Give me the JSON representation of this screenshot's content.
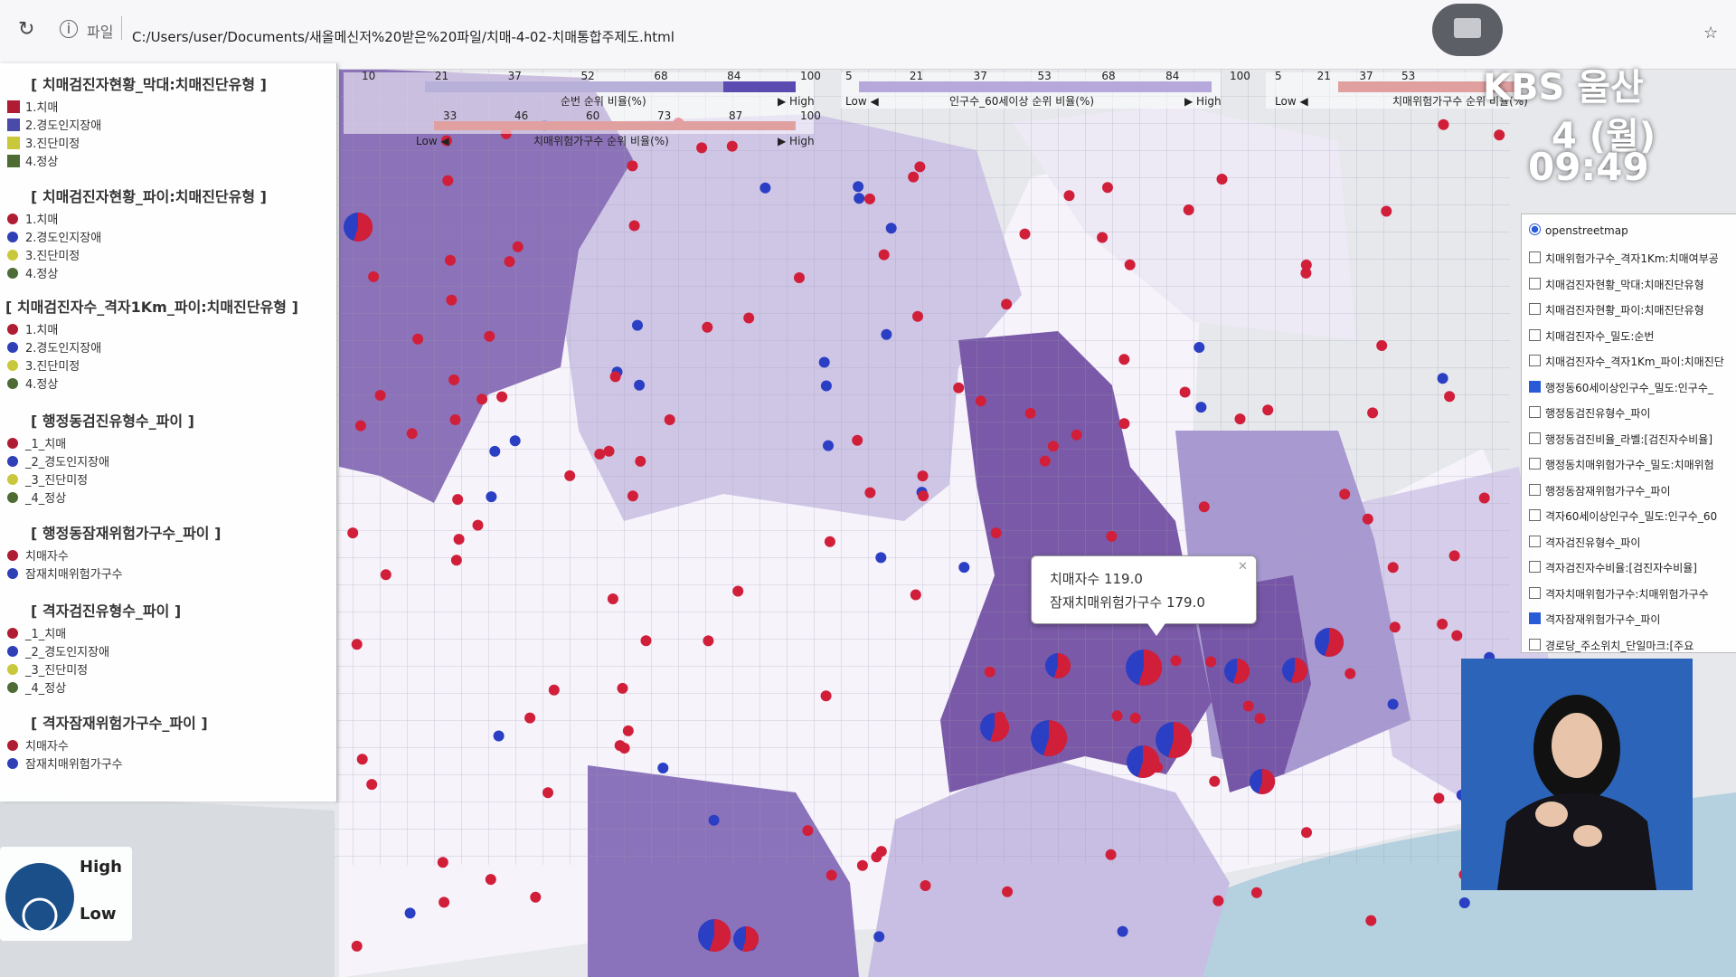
{
  "browser": {
    "file_label": "파일",
    "url": "C:/Users/user/Documents/새올메신저%20받은%20파일/치매-4-02-치매통합주제도.html"
  },
  "scales": [
    {
      "ticks": [
        "10",
        "21",
        "37",
        "52",
        "68",
        "84",
        "100"
      ],
      "label": "순번 순위 비율(%)",
      "low": "",
      "high": "High"
    },
    {
      "ticks": [
        "5",
        "21",
        "37",
        "53",
        "68",
        "84",
        "100"
      ],
      "label": "인구수_60세이상 순위 비율(%)",
      "low": "Low",
      "high": "High"
    },
    {
      "ticks": [
        "5",
        "21",
        "37",
        "53"
      ],
      "label": "치매위험가구수 순위 비율(%)",
      "low": "Low",
      "high": ""
    },
    {
      "ticks": [
        "33",
        "46",
        "60",
        "73",
        "87",
        "100"
      ],
      "label": "치매위험가구수 순위 비율(%)",
      "low": "Low",
      "high": "High"
    }
  ],
  "legend": {
    "sections": [
      {
        "title": "[ 치매검진자현황_막대:치매진단유형 ]",
        "kind": "bar",
        "items": [
          {
            "label": "1.치매",
            "color": "#b01c34"
          },
          {
            "label": "2.경도인지장애",
            "color": "#4a4aa8"
          },
          {
            "label": "3.진단미정",
            "color": "#c8c83a"
          },
          {
            "label": "4.정상",
            "color": "#4f6b34"
          }
        ]
      },
      {
        "title": "[ 치매검진자현황_파이:치매진단유형 ]",
        "kind": "pie",
        "items": [
          {
            "label": "1.치매",
            "color": "#b01c34"
          },
          {
            "label": "2.경도인지장애",
            "color": "#2f3fb5"
          },
          {
            "label": "3.진단미정",
            "color": "#c8c83a"
          },
          {
            "label": "4.정상",
            "color": "#4f6b34"
          }
        ]
      },
      {
        "title": "[ 치매검진자수_격자1Km_파이:치매진단유형 ]",
        "kind": "pie",
        "items": [
          {
            "label": "1.치매",
            "color": "#b01c34"
          },
          {
            "label": "2.경도인지장애",
            "color": "#2f3fb5"
          },
          {
            "label": "3.진단미정",
            "color": "#c8c83a"
          },
          {
            "label": "4.정상",
            "color": "#4f6b34"
          }
        ]
      },
      {
        "title": "[ 행정동검진유형수_파이 ]",
        "kind": "pie",
        "items": [
          {
            "label": "_1_치매",
            "color": "#b01c34"
          },
          {
            "label": "_2_경도인지장애",
            "color": "#2f3fb5"
          },
          {
            "label": "_3_진단미정",
            "color": "#c8c83a"
          },
          {
            "label": "_4_정상",
            "color": "#4f6b34"
          }
        ]
      },
      {
        "title": "[ 행정동잠재위험가구수_파이 ]",
        "kind": "pie",
        "items": [
          {
            "label": "치매자수",
            "color": "#b01c34"
          },
          {
            "label": "잠재치매위험가구수",
            "color": "#2f3fb5"
          }
        ]
      },
      {
        "title": "[ 격자검진유형수_파이 ]",
        "kind": "pie",
        "items": [
          {
            "label": "_1_치매",
            "color": "#b01c34"
          },
          {
            "label": "_2_경도인지장애",
            "color": "#2f3fb5"
          },
          {
            "label": "_3_진단미정",
            "color": "#c8c83a"
          },
          {
            "label": "_4_정상",
            "color": "#4f6b34"
          }
        ]
      },
      {
        "title": "[ 격자잠재위험가구수_파이 ]",
        "kind": "pie",
        "items": [
          {
            "label": "치매자수",
            "color": "#b01c34"
          },
          {
            "label": "잠재치매위험가구수",
            "color": "#2f3fb5"
          }
        ]
      }
    ]
  },
  "size_legend": {
    "high": "High",
    "low": "Low"
  },
  "layers": {
    "base": "openstreetmap",
    "items": [
      {
        "label": "치매위험가구수_격자1Km:치매여부공",
        "checked": false
      },
      {
        "label": "치매검진자현황_막대:치매진단유형",
        "checked": false
      },
      {
        "label": "치매검진자현황_파이:치매진단유형",
        "checked": false
      },
      {
        "label": "치매검진자수_밀도:순번",
        "checked": false
      },
      {
        "label": "치매검진자수_격자1Km_파이:치매진단",
        "checked": false
      },
      {
        "label": "행정동60세이상인구수_밀도:인구수_",
        "checked": true
      },
      {
        "label": "행정동검진유형수_파이",
        "checked": false
      },
      {
        "label": "행정동검진비율_라벨:[검진자수비율]",
        "checked": false
      },
      {
        "label": "행정동치매위험가구수_밀도:치매위험",
        "checked": false
      },
      {
        "label": "행정동잠재위험가구수_파이",
        "checked": false
      },
      {
        "label": "격자60세이상인구수_밀도:인구수_60",
        "checked": false
      },
      {
        "label": "격자검진유형수_파이",
        "checked": false
      },
      {
        "label": "격자검진자수비율:[검진자수비율]",
        "checked": false
      },
      {
        "label": "격자치매위험가구수:치매위험가구수",
        "checked": false
      },
      {
        "label": "격자잠재위험가구수_파이",
        "checked": true
      },
      {
        "label": "경로당_주소위치_단일마크:[주요",
        "checked": false
      }
    ]
  },
  "popup": {
    "line1": "치매자수  119.0",
    "line2": "잠재치매위험가구수  179.0"
  },
  "broadcast": {
    "station": "KBS 울산",
    "date": "4 (월)",
    "time": "09:49"
  },
  "colors": {
    "dementia": "#d11f3a",
    "risk": "#2b3fc4",
    "region_dark": "#7a5aa8",
    "region_mid": "#a392cc",
    "region_light": "#d5cde9"
  }
}
